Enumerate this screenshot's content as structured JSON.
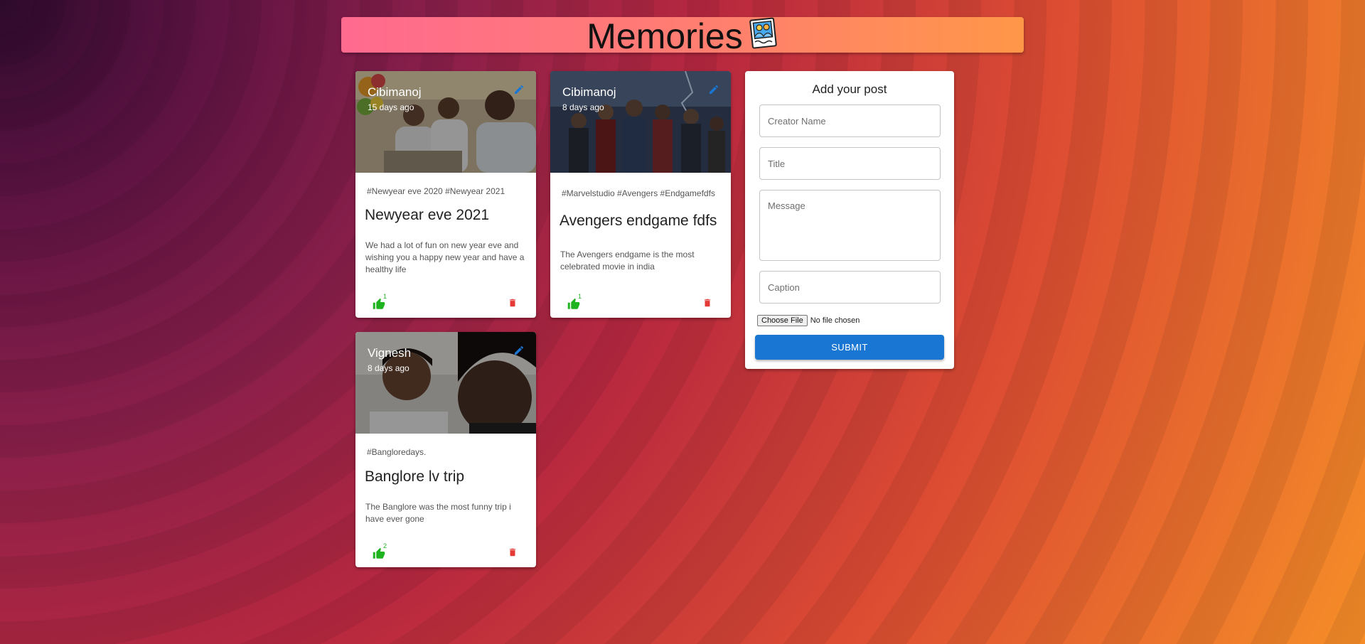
{
  "app": {
    "title": "Memories",
    "logo_icon": "memories-photo-logo"
  },
  "posts": [
    {
      "creator": "Cibimanoj",
      "time": "15 days ago",
      "tags": "#Newyear eve 2020 #Newyear 2021",
      "title": "Newyear eve 2021",
      "message": "We had a lot of fun on new year eve and wishing you a happy new year and have a healthy life",
      "likes": "1"
    },
    {
      "creator": "Cibimanoj",
      "time": "8 days ago",
      "tags": "#Marvelstudio #Avengers #Endgamefdfs",
      "title": "Avengers endgame fdfs",
      "message": "The Avengers endgame is the most celebrated movie in india",
      "likes": "1"
    },
    {
      "creator": "Vignesh",
      "time": "8 days ago",
      "tags": "#Bangloredays.",
      "title": "Banglore lv trip",
      "message": "The Banglore was the most funny trip i have ever gone",
      "likes": "2"
    }
  ],
  "form": {
    "title": "Add your post",
    "creator_placeholder": "Creator Name",
    "title_placeholder": "Title",
    "message_placeholder": "Message",
    "caption_placeholder": "Caption",
    "choose_file_label": "Choose File",
    "file_status": "No file chosen",
    "submit_label": "SUBMIT"
  },
  "colors": {
    "like": "#1fb31f",
    "delete": "#e53935",
    "edit": "#1976d2",
    "submit": "#1976d2"
  }
}
